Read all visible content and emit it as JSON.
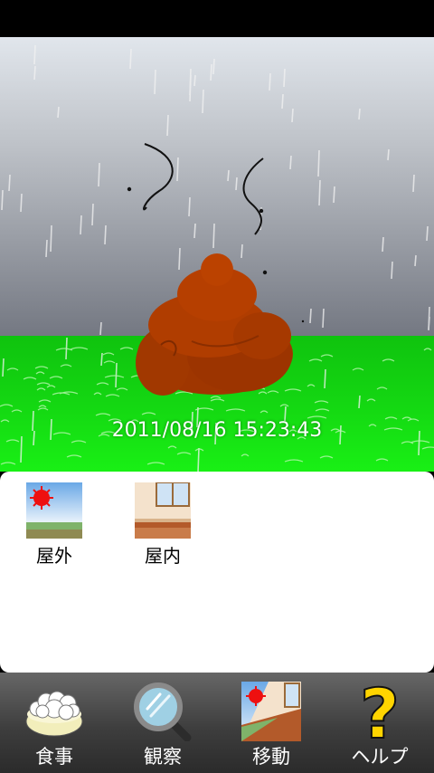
{
  "scene": {
    "timestamp": "2011/08/16 15:23:43",
    "weather": "rain",
    "colors": {
      "sky_top": "#dfe4ea",
      "sky_bottom": "#757982",
      "grass": "#15e112",
      "poop": "#a53800"
    }
  },
  "location_panel": {
    "options": [
      {
        "label": "屋外",
        "icon": "outdoor-scene-icon"
      },
      {
        "label": "屋内",
        "icon": "indoor-room-icon"
      }
    ]
  },
  "toolbar": {
    "buttons": [
      {
        "label": "食事",
        "icon": "rice-bowl-icon"
      },
      {
        "label": "観察",
        "icon": "magnifier-icon"
      },
      {
        "label": "移動",
        "icon": "move-location-icon",
        "selected": true
      },
      {
        "label": "ヘルプ",
        "icon": "question-mark-icon"
      }
    ]
  }
}
